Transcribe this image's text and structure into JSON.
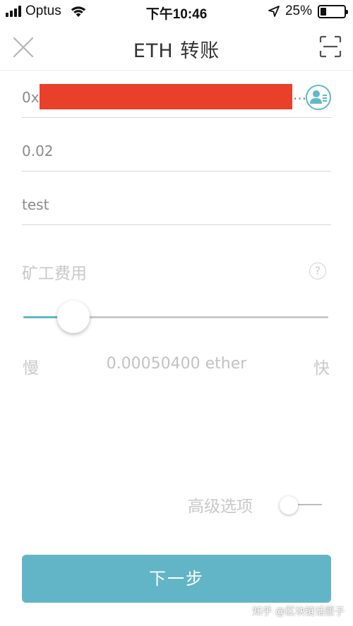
{
  "status_bar": {
    "carrier": "Optus",
    "time": "下午10:46",
    "battery_percent": "25%",
    "battery_level": 0.25
  },
  "nav": {
    "title": "ETH 转账",
    "close_icon": "close-icon",
    "scan_icon": "scan-icon"
  },
  "form": {
    "address": {
      "prefix": "0x",
      "suffix": "...",
      "contacts_icon": "contacts-icon"
    },
    "amount": {
      "value": "0.02"
    },
    "memo": {
      "value": "test"
    }
  },
  "fee": {
    "label": "矿工费用",
    "help_symbol": "?",
    "slider_level": 0.16,
    "slow_label": "慢",
    "value": "0.00050400 ether",
    "fast_label": "快"
  },
  "advanced": {
    "label": "高级选项",
    "enabled": false
  },
  "next_button": {
    "label": "下一步"
  },
  "watermark": "知乎 @区块链话匣子",
  "colors": {
    "accent": "#5fb8c7",
    "button": "#62b5c6",
    "redaction": "#e8402b"
  }
}
